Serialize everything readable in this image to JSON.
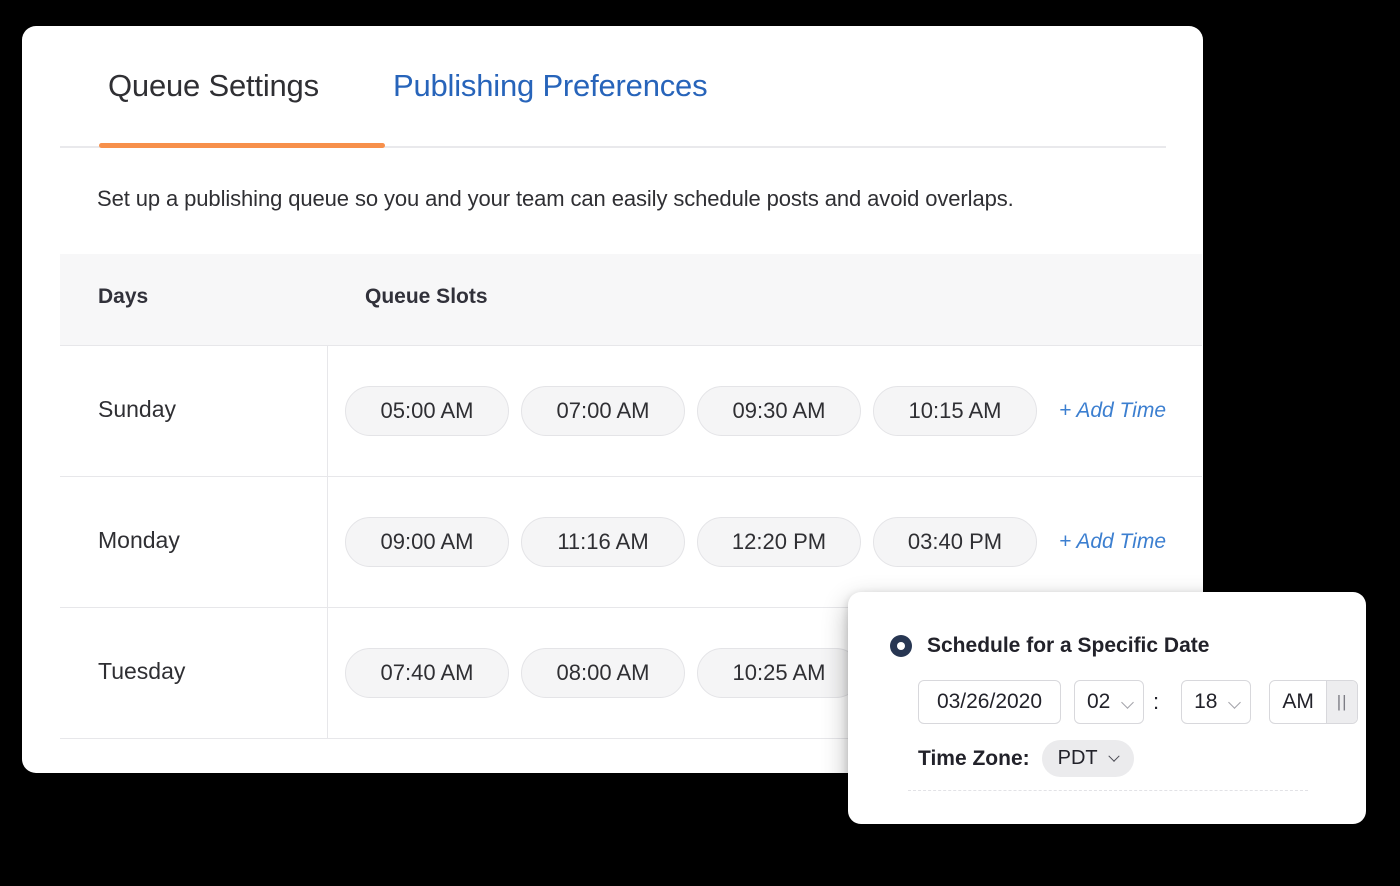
{
  "tabs": [
    {
      "label": "Queue Settings",
      "active": true
    },
    {
      "label": "Publishing Preferences",
      "active": false
    }
  ],
  "description": "Set up a publishing queue so you and your team can easily schedule posts and avoid overlaps.",
  "table": {
    "headers": {
      "days": "Days",
      "slots": "Queue Slots"
    },
    "add_time_label": "+ Add Time",
    "rows": [
      {
        "day": "Sunday",
        "slots": [
          "05:00 AM",
          "07:00 AM",
          "09:30 AM",
          "10:15 AM"
        ]
      },
      {
        "day": "Monday",
        "slots": [
          "09:00 AM",
          "11:16 AM",
          "12:20 PM",
          "03:40 PM"
        ]
      },
      {
        "day": "Tuesday",
        "slots": [
          "07:40 AM",
          "08:00 AM",
          "10:25 AM"
        ]
      }
    ]
  },
  "schedule_popup": {
    "radio_label": "Schedule for a Specific Date",
    "date_value": "03/26/2020",
    "hour_value": "02",
    "colon": ":",
    "minute_value": "18",
    "meridiem_value": "AM",
    "spinner_glyph": "||",
    "timezone_label": "Time Zone:",
    "timezone_value": "PDT"
  },
  "colors": {
    "accent_orange": "#f7904b",
    "link_blue": "#3c7fd0",
    "tab_blue": "#2764ba",
    "radio_navy": "#273652",
    "pill_gray": "#f5f5f6"
  }
}
